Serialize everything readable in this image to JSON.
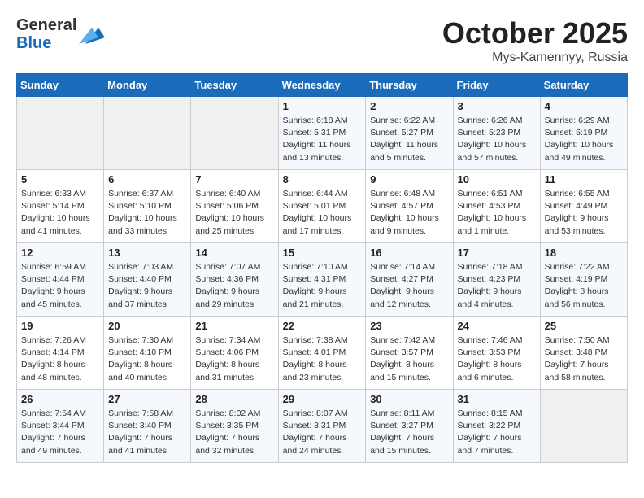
{
  "header": {
    "logo_line1": "General",
    "logo_line2": "Blue",
    "month": "October 2025",
    "location": "Mys-Kamennyy, Russia"
  },
  "columns": [
    "Sunday",
    "Monday",
    "Tuesday",
    "Wednesday",
    "Thursday",
    "Friday",
    "Saturday"
  ],
  "weeks": [
    [
      {
        "day": "",
        "info": ""
      },
      {
        "day": "",
        "info": ""
      },
      {
        "day": "",
        "info": ""
      },
      {
        "day": "1",
        "info": "Sunrise: 6:18 AM\nSunset: 5:31 PM\nDaylight: 11 hours\nand 13 minutes."
      },
      {
        "day": "2",
        "info": "Sunrise: 6:22 AM\nSunset: 5:27 PM\nDaylight: 11 hours\nand 5 minutes."
      },
      {
        "day": "3",
        "info": "Sunrise: 6:26 AM\nSunset: 5:23 PM\nDaylight: 10 hours\nand 57 minutes."
      },
      {
        "day": "4",
        "info": "Sunrise: 6:29 AM\nSunset: 5:19 PM\nDaylight: 10 hours\nand 49 minutes."
      }
    ],
    [
      {
        "day": "5",
        "info": "Sunrise: 6:33 AM\nSunset: 5:14 PM\nDaylight: 10 hours\nand 41 minutes."
      },
      {
        "day": "6",
        "info": "Sunrise: 6:37 AM\nSunset: 5:10 PM\nDaylight: 10 hours\nand 33 minutes."
      },
      {
        "day": "7",
        "info": "Sunrise: 6:40 AM\nSunset: 5:06 PM\nDaylight: 10 hours\nand 25 minutes."
      },
      {
        "day": "8",
        "info": "Sunrise: 6:44 AM\nSunset: 5:01 PM\nDaylight: 10 hours\nand 17 minutes."
      },
      {
        "day": "9",
        "info": "Sunrise: 6:48 AM\nSunset: 4:57 PM\nDaylight: 10 hours\nand 9 minutes."
      },
      {
        "day": "10",
        "info": "Sunrise: 6:51 AM\nSunset: 4:53 PM\nDaylight: 10 hours\nand 1 minute."
      },
      {
        "day": "11",
        "info": "Sunrise: 6:55 AM\nSunset: 4:49 PM\nDaylight: 9 hours\nand 53 minutes."
      }
    ],
    [
      {
        "day": "12",
        "info": "Sunrise: 6:59 AM\nSunset: 4:44 PM\nDaylight: 9 hours\nand 45 minutes."
      },
      {
        "day": "13",
        "info": "Sunrise: 7:03 AM\nSunset: 4:40 PM\nDaylight: 9 hours\nand 37 minutes."
      },
      {
        "day": "14",
        "info": "Sunrise: 7:07 AM\nSunset: 4:36 PM\nDaylight: 9 hours\nand 29 minutes."
      },
      {
        "day": "15",
        "info": "Sunrise: 7:10 AM\nSunset: 4:31 PM\nDaylight: 9 hours\nand 21 minutes."
      },
      {
        "day": "16",
        "info": "Sunrise: 7:14 AM\nSunset: 4:27 PM\nDaylight: 9 hours\nand 12 minutes."
      },
      {
        "day": "17",
        "info": "Sunrise: 7:18 AM\nSunset: 4:23 PM\nDaylight: 9 hours\nand 4 minutes."
      },
      {
        "day": "18",
        "info": "Sunrise: 7:22 AM\nSunset: 4:19 PM\nDaylight: 8 hours\nand 56 minutes."
      }
    ],
    [
      {
        "day": "19",
        "info": "Sunrise: 7:26 AM\nSunset: 4:14 PM\nDaylight: 8 hours\nand 48 minutes."
      },
      {
        "day": "20",
        "info": "Sunrise: 7:30 AM\nSunset: 4:10 PM\nDaylight: 8 hours\nand 40 minutes."
      },
      {
        "day": "21",
        "info": "Sunrise: 7:34 AM\nSunset: 4:06 PM\nDaylight: 8 hours\nand 31 minutes."
      },
      {
        "day": "22",
        "info": "Sunrise: 7:38 AM\nSunset: 4:01 PM\nDaylight: 8 hours\nand 23 minutes."
      },
      {
        "day": "23",
        "info": "Sunrise: 7:42 AM\nSunset: 3:57 PM\nDaylight: 8 hours\nand 15 minutes."
      },
      {
        "day": "24",
        "info": "Sunrise: 7:46 AM\nSunset: 3:53 PM\nDaylight: 8 hours\nand 6 minutes."
      },
      {
        "day": "25",
        "info": "Sunrise: 7:50 AM\nSunset: 3:48 PM\nDaylight: 7 hours\nand 58 minutes."
      }
    ],
    [
      {
        "day": "26",
        "info": "Sunrise: 7:54 AM\nSunset: 3:44 PM\nDaylight: 7 hours\nand 49 minutes."
      },
      {
        "day": "27",
        "info": "Sunrise: 7:58 AM\nSunset: 3:40 PM\nDaylight: 7 hours\nand 41 minutes."
      },
      {
        "day": "28",
        "info": "Sunrise: 8:02 AM\nSunset: 3:35 PM\nDaylight: 7 hours\nand 32 minutes."
      },
      {
        "day": "29",
        "info": "Sunrise: 8:07 AM\nSunset: 3:31 PM\nDaylight: 7 hours\nand 24 minutes."
      },
      {
        "day": "30",
        "info": "Sunrise: 8:11 AM\nSunset: 3:27 PM\nDaylight: 7 hours\nand 15 minutes."
      },
      {
        "day": "31",
        "info": "Sunrise: 8:15 AM\nSunset: 3:22 PM\nDaylight: 7 hours\nand 7 minutes."
      },
      {
        "day": "",
        "info": ""
      }
    ]
  ]
}
